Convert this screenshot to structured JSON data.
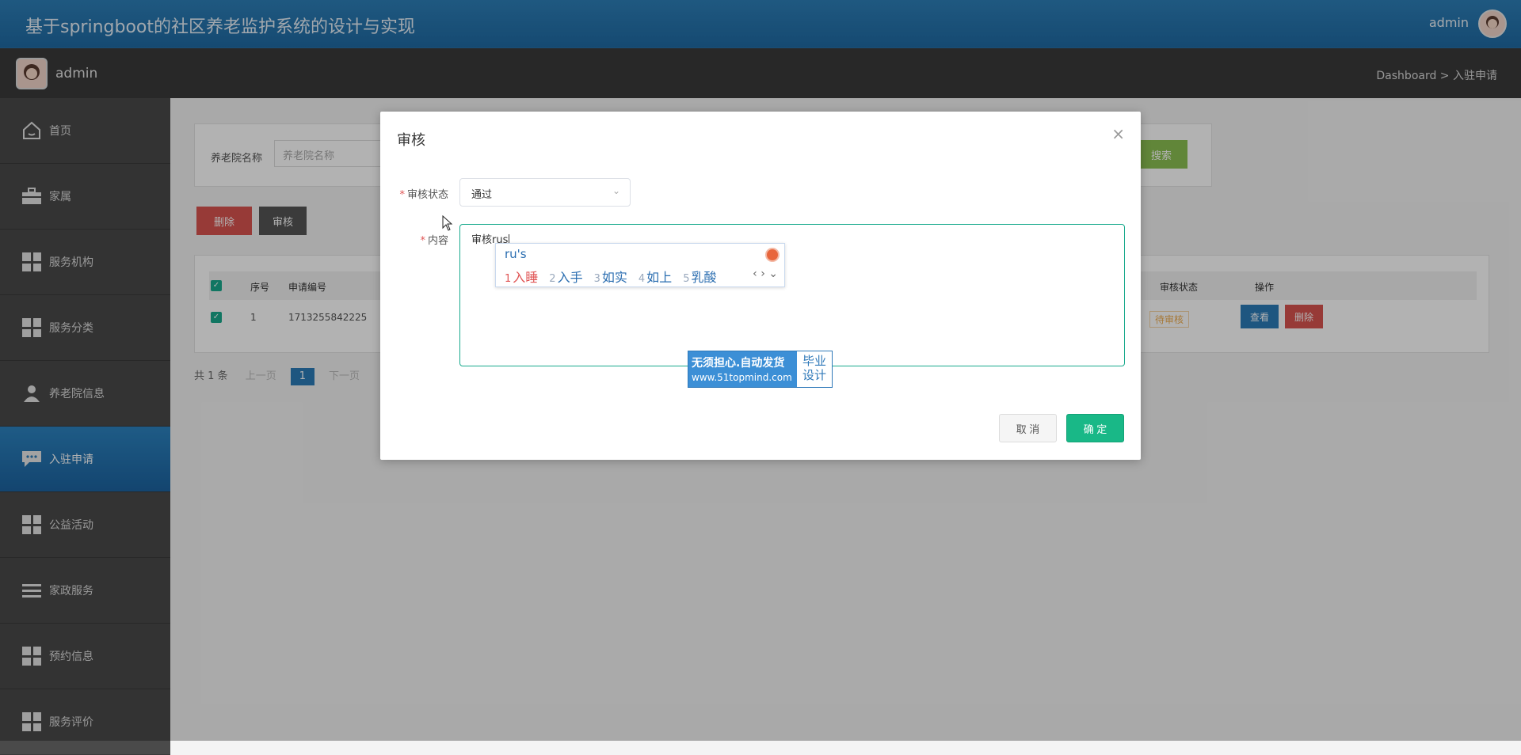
{
  "header": {
    "title": "基于springboot的社区养老监护系统的设计与实现",
    "user": "admin"
  },
  "subbar": {
    "username": "admin",
    "breadcrumb": "Dashboard > 入驻申请"
  },
  "sidebar": {
    "items": [
      {
        "label": "首页",
        "icon": "home-icon"
      },
      {
        "label": "家属",
        "icon": "briefcase-icon"
      },
      {
        "label": "服务机构",
        "icon": "grid-icon"
      },
      {
        "label": "服务分类",
        "icon": "grid-icon"
      },
      {
        "label": "养老院信息",
        "icon": "user-icon"
      },
      {
        "label": "入驻申请",
        "icon": "chat-icon",
        "active": true
      },
      {
        "label": "公益活动",
        "icon": "grid-icon"
      },
      {
        "label": "家政服务",
        "icon": "list-icon"
      },
      {
        "label": "预约信息",
        "icon": "grid-icon"
      },
      {
        "label": "服务评价",
        "icon": "grid-icon"
      }
    ]
  },
  "search": {
    "label": "养老院名称",
    "placeholder": "养老院名称",
    "button": "搜索"
  },
  "actions": {
    "delete": "删除",
    "review": "审核"
  },
  "table": {
    "headers": {
      "index": "序号",
      "app_no": "申请编号",
      "status": "审核状态",
      "ops": "操作"
    },
    "rows": [
      {
        "index": "1",
        "app_no": "1713255842225",
        "status": "待审核",
        "view": "查看",
        "delete": "删除"
      }
    ]
  },
  "pager": {
    "total": "共 1 条",
    "prev": "上一页",
    "page": "1",
    "next": "下一页"
  },
  "modal": {
    "title": "审核",
    "status_label": "审核状态",
    "status_value": "通过",
    "content_label": "内容",
    "content_value": "审核rus",
    "cancel": "取 消",
    "confirm": "确 定"
  },
  "ime": {
    "typed": "ru's",
    "candidates": [
      {
        "n": "1",
        "text": "入睡"
      },
      {
        "n": "2",
        "text": "入手"
      },
      {
        "n": "3",
        "text": "如实"
      },
      {
        "n": "4",
        "text": "如上"
      },
      {
        "n": "5",
        "text": "乳酸"
      }
    ],
    "nav": "‹ › ⌄"
  },
  "watermark": {
    "line1": "无须担心.自动发货",
    "line2": "www.51topmind.com",
    "badge": "毕业设计"
  }
}
